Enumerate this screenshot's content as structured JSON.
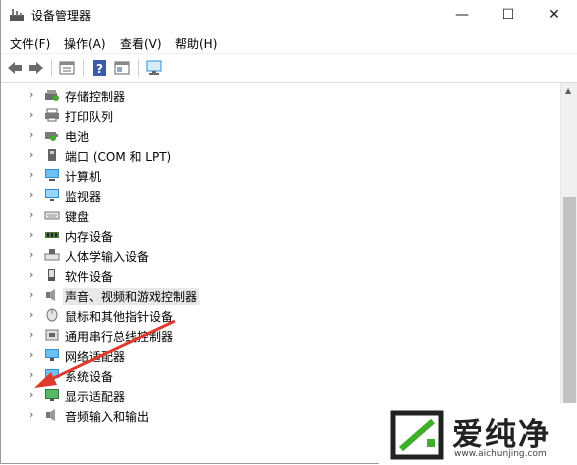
{
  "window": {
    "title": "设备管理器"
  },
  "menu": [
    "文件(F)",
    "操作(A)",
    "查看(V)",
    "帮助(H)"
  ],
  "tree_items": [
    {
      "label": "存储控制器",
      "icon": "storage-controller-icon"
    },
    {
      "label": "打印队列",
      "icon": "printer-icon"
    },
    {
      "label": "电池",
      "icon": "battery-icon"
    },
    {
      "label": "端口 (COM 和 LPT)",
      "icon": "port-icon"
    },
    {
      "label": "计算机",
      "icon": "computer-icon"
    },
    {
      "label": "监视器",
      "icon": "monitor-icon"
    },
    {
      "label": "键盘",
      "icon": "keyboard-icon"
    },
    {
      "label": "内存设备",
      "icon": "memory-icon"
    },
    {
      "label": "人体学输入设备",
      "icon": "hid-icon"
    },
    {
      "label": "软件设备",
      "icon": "software-device-icon"
    },
    {
      "label": "声音、视频和游戏控制器",
      "icon": "speaker-icon",
      "selected": true
    },
    {
      "label": "鼠标和其他指针设备",
      "icon": "mouse-icon"
    },
    {
      "label": "通用串行总线控制器",
      "icon": "usb-icon"
    },
    {
      "label": "网络适配器",
      "icon": "network-adapter-icon"
    },
    {
      "label": "系统设备",
      "icon": "system-device-icon"
    },
    {
      "label": "显示适配器",
      "icon": "display-adapter-icon"
    },
    {
      "label": "音频输入和输出",
      "icon": "audio-io-icon"
    }
  ],
  "watermark": {
    "text": "爱纯净",
    "url": "www.aichunjing.com"
  },
  "colors": {
    "arrow": "#e0392e",
    "thumb": "#c1c1c1",
    "monitor": "#2f8fd6"
  }
}
